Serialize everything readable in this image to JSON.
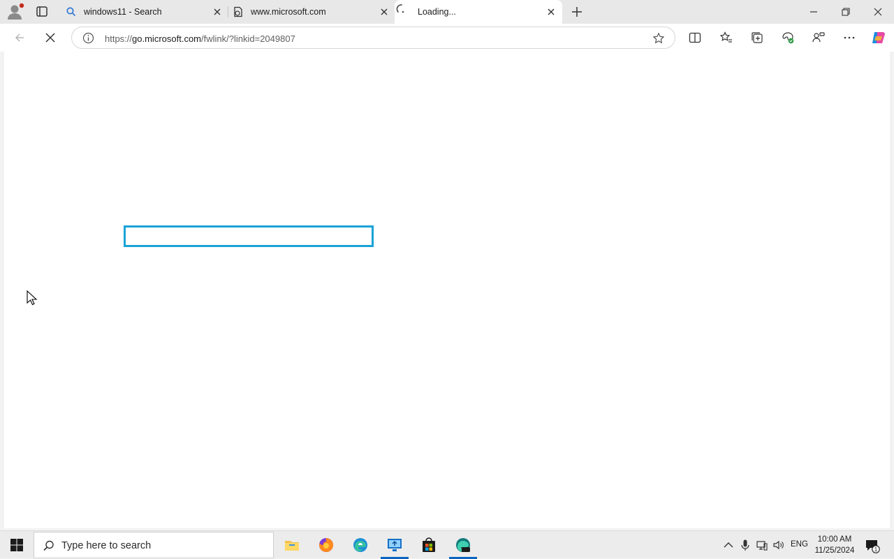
{
  "browser": {
    "tabs": [
      {
        "title": "windows11 - Search",
        "icon": "search-icon"
      },
      {
        "title": "www.microsoft.com",
        "icon": "page-icon"
      },
      {
        "title": "Loading...",
        "icon": "loading-spinner-icon",
        "active": true
      }
    ],
    "address": {
      "url_prefix": "https://",
      "url_host": "go.microsoft.com",
      "url_rest": "/fwlink/?linkid=2049807"
    }
  },
  "taskbar": {
    "search_placeholder": "Type here to search",
    "language": "ENG",
    "time": "10:00 AM",
    "date": "11/25/2024",
    "notification_count": "1",
    "apps": [
      "file-explorer-icon",
      "firefox-icon",
      "edge-icon",
      "remote-desktop-icon",
      "store-icon",
      "edge-dev-icon"
    ]
  },
  "colors": {
    "focus_outline": "#1aa3d6",
    "taskbar_accent": "#0a64c2"
  }
}
